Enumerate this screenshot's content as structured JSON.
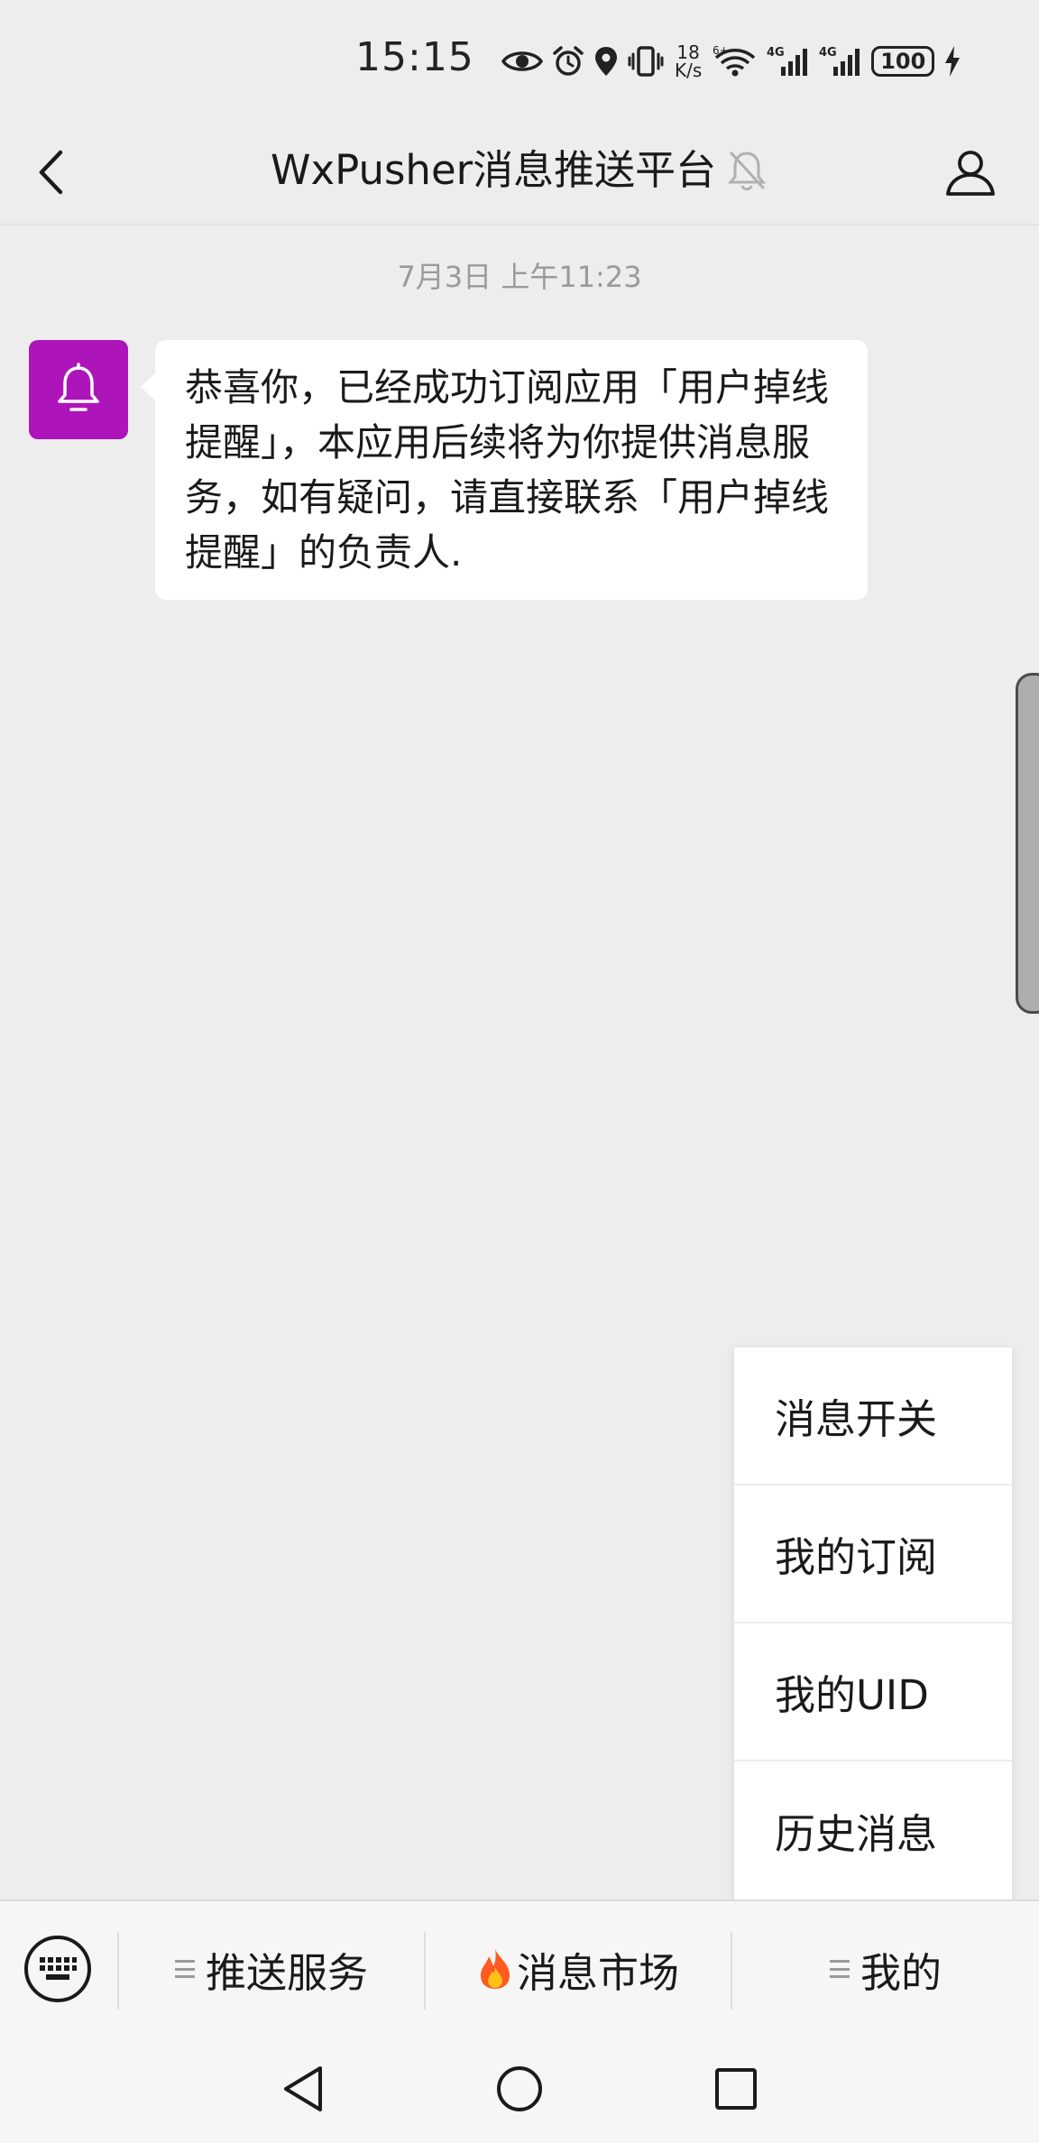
{
  "status_bar": {
    "time": "15:15",
    "net_speed_value": "18",
    "net_speed_unit": "K/s",
    "battery": "100",
    "icons": [
      "eye-icon",
      "alarm-icon",
      "location-icon",
      "vibrate-icon",
      "wifi-6-icon",
      "signal-4g-icon",
      "signal-4g-icon",
      "battery-icon",
      "charging-icon"
    ]
  },
  "header": {
    "title": "WxPusher消息推送平台",
    "icons": [
      "back-arrow-icon",
      "mute-bell-icon",
      "profile-icon"
    ]
  },
  "chat": {
    "timestamp": "7月3日 上午11:23",
    "avatar_icon": "bell-icon",
    "avatar_color": "#ad15ba",
    "message": "恭喜你，已经成功订阅应用「用户掉线提醒」，本应用后续将为你提供消息服务，如有疑问，请直接联系「用户掉线提醒」的负责人."
  },
  "popup_menu": {
    "items": [
      {
        "label": "消息开关"
      },
      {
        "label": "我的订阅"
      },
      {
        "label": "我的UID"
      },
      {
        "label": "历史消息"
      }
    ]
  },
  "menu_bar": {
    "keyboard_icon": "keyboard-icon",
    "tabs": [
      {
        "label": "推送服务",
        "icon": "menu-lines-icon"
      },
      {
        "label": "消息市场",
        "icon": "fire-icon"
      },
      {
        "label": "我的",
        "icon": "menu-lines-icon"
      }
    ]
  },
  "nav_bar": {
    "icons": [
      "nav-back-icon",
      "nav-home-icon",
      "nav-recents-icon"
    ]
  }
}
